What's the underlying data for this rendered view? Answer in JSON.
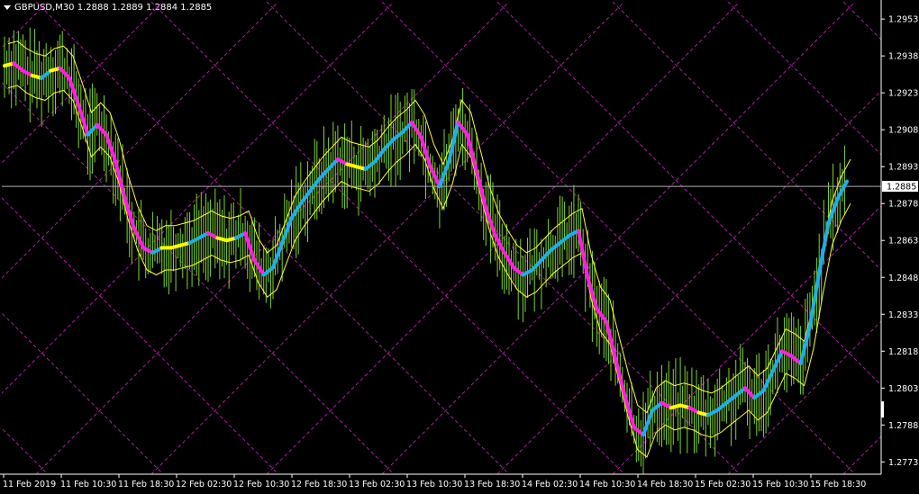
{
  "header": {
    "symbol": "GBPUSD,M30",
    "open": "1.2888",
    "high": "1.2889",
    "low": "1.2884",
    "close": "1.2885"
  },
  "colors": {
    "background": "#000000",
    "bars": "#7fd624",
    "envelope": "#ffff33",
    "trend_up": "#1eaee8",
    "trend_down": "#ff1ee6",
    "trend_flat": "#ffff00",
    "grid": "#b01ea0",
    "axis": "#ffffff",
    "price_line": "#b0b0b0"
  },
  "chart_data": {
    "type": "line",
    "ylim": [
      1.2768,
      1.296
    ],
    "yticks": [
      "1.2953",
      "1.2938",
      "1.2923",
      "1.2908",
      "1.2893",
      "1.2878",
      "1.2863",
      "1.2848",
      "1.2833",
      "1.2818",
      "1.2803",
      "1.2788",
      "1.2773"
    ],
    "xticks": [
      "11 Feb 2019",
      "11 Feb 10:30",
      "11 Feb 18:30",
      "12 Feb 02:30",
      "12 Feb 10:30",
      "12 Feb 18:30",
      "13 Feb 02:30",
      "13 Feb 10:30",
      "13 Feb 18:30",
      "14 Feb 02:30",
      "14 Feb 10:30",
      "14 Feb 18:30",
      "15 Feb 02:30",
      "15 Feb 10:30",
      "15 Feb 18:30"
    ],
    "current_price": "1.2885",
    "grid": "diagonal dashed",
    "series": [
      {
        "values": [
          1.2934,
          1.2935,
          1.2932,
          1.293,
          1.2929,
          1.2932,
          1.2933,
          1.2929,
          1.2918,
          1.2906,
          1.291,
          1.2906,
          1.2895,
          1.288,
          1.2868,
          1.286,
          1.2858,
          1.286,
          1.286,
          1.2861,
          1.2862,
          1.2864,
          1.2866,
          1.2864,
          1.2863,
          1.2864,
          1.2866,
          1.2855,
          1.2849,
          1.2852,
          1.2862,
          1.2872,
          1.2878,
          1.2883,
          1.2888,
          1.2892,
          1.2896,
          1.2894,
          1.2893,
          1.2892,
          1.2895,
          1.29,
          1.2904,
          1.2907,
          1.2911,
          1.2905,
          1.2893,
          1.2885,
          1.2895,
          1.2911,
          1.2906,
          1.2891,
          1.2876,
          1.2865,
          1.2858,
          1.2852,
          1.2849,
          1.2851,
          1.2855,
          1.2859,
          1.2862,
          1.2865,
          1.2867,
          1.2848,
          1.2835,
          1.283,
          1.2815,
          1.28,
          1.2787,
          1.2784,
          1.2794,
          1.2797,
          1.2795,
          1.2796,
          1.2795,
          1.2793,
          1.2792,
          1.2794,
          1.2797,
          1.28,
          1.2803,
          1.2799,
          1.2802,
          1.281,
          1.2818,
          1.2816,
          1.2813,
          1.2828,
          1.285,
          1.287,
          1.288,
          1.2887
        ]
      }
    ]
  }
}
